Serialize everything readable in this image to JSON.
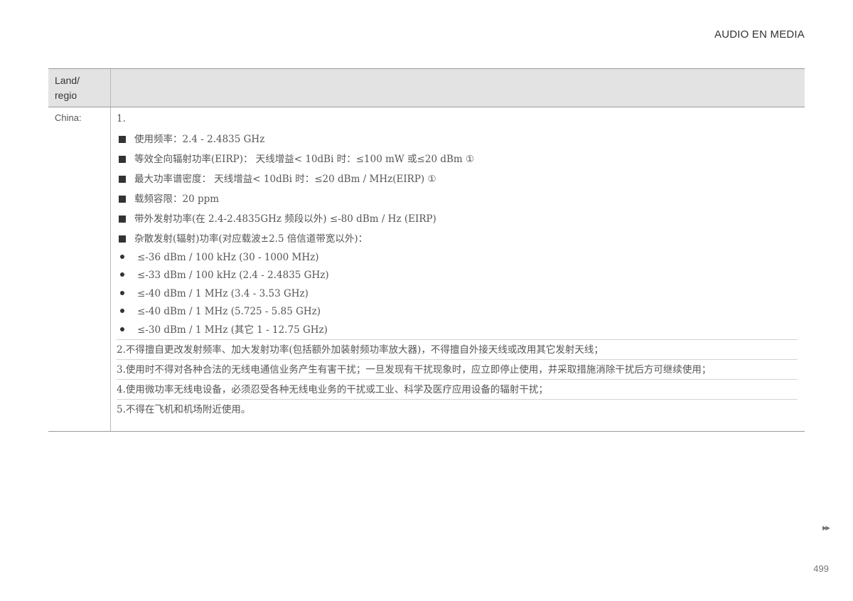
{
  "header": {
    "section": "AUDIO EN MEDIA"
  },
  "table": {
    "col_label": "Land/\nregio",
    "country": "China:",
    "item_number": "1.",
    "square_items": [
      "使用频率：2.4 - 2.4835 GHz",
      "等效全向辐射功率(EIRP)： 天线增益< 10dBi 时：≤100 mW 或≤20 dBm ①",
      "最大功率谱密度： 天线增益< 10dBi 时：≤20 dBm / MHz(EIRP) ①",
      "载频容限：20 ppm",
      "带外发射功率(在 2.4-2.4835GHz 频段以外) ≤-80 dBm / Hz (EIRP)",
      "杂散发射(辐射)功率(对应载波±2.5 倍信道带宽以外)："
    ],
    "dot_items": [
      "≤-36 dBm / 100 kHz (30 - 1000 MHz)",
      "≤-33 dBm / 100 kHz (2.4 - 2.4835 GHz)",
      "≤-40 dBm / 1 MHz (3.4 - 3.53 GHz)",
      "≤-40 dBm / 1 MHz (5.725 - 5.85 GHz)",
      "≤-30 dBm / 1 MHz (其它 1 - 12.75 GHz)"
    ],
    "paragraphs": [
      "2.不得擅自更改发射频率、加大发射功率(包括额外加装射频功率放大器)，不得擅自外接天线或改用其它发射天线；",
      "3.使用时不得对各种合法的无线电通信业务产生有害干扰；一旦发现有干扰现象时，应立即停止使用，并采取措施消除干扰后方可继续使用；",
      "4.使用微功率无线电设备，必须忍受各种无线电业务的干扰或工业、科学及医疗应用设备的辐射干扰；",
      "5.不得在飞机和机场附近使用。"
    ]
  },
  "footer": {
    "next_page_marker": "▸▸",
    "page_number": "499"
  }
}
